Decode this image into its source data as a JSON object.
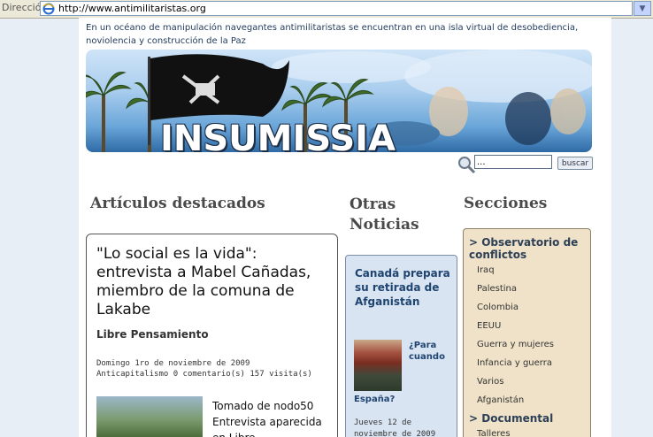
{
  "browser": {
    "address_label": "Dirección",
    "url": "http://www.antimilitaristas.org"
  },
  "site": {
    "tagline": "En un océano de manipulación navegantes antimilitaristas se encuentran en una isla virtual de desobediencia, noviolencia y construcción de la Paz",
    "banner_title": "INSUMISSIA"
  },
  "search": {
    "value": "...",
    "button_label": "buscar"
  },
  "headings": {
    "articulos": "Artículos destacados",
    "otras_line1": "Otras",
    "otras_line2": "Noticias",
    "secciones": "Secciones"
  },
  "article": {
    "title": "\"Lo social es la vida\": entrevista a Mabel Cañadas, miembro de la comuna de Lakabe",
    "category": "Libre Pensamiento",
    "date": "Domingo 1ro de noviembre de 2009",
    "meta": "Anticapitalismo 0 comentario(s) 157 visita(s)",
    "snippet": "Tomado de nodo50 Entrevista aparecida en Libre"
  },
  "noticias": {
    "title": "Canadá prepara su retirada de Afganistán",
    "link_part1": "¿Para cuando",
    "link_part2": "España?",
    "date": "Jueves 12 de noviembre de 2009"
  },
  "secciones": {
    "group1": "> Observatorio de conflictos",
    "items1": [
      "Iraq",
      "Palestina",
      "Colombia",
      "EEUU",
      "Guerra y mujeres",
      "Infancia y guerra",
      "Varios",
      "Afganistán"
    ],
    "group2": "> Documental",
    "items2": [
      "Talleres"
    ]
  },
  "colors": {
    "link": "#1f4470",
    "noticias_bg": "#d9e4f2",
    "secciones_bg": "#efe2c8"
  }
}
